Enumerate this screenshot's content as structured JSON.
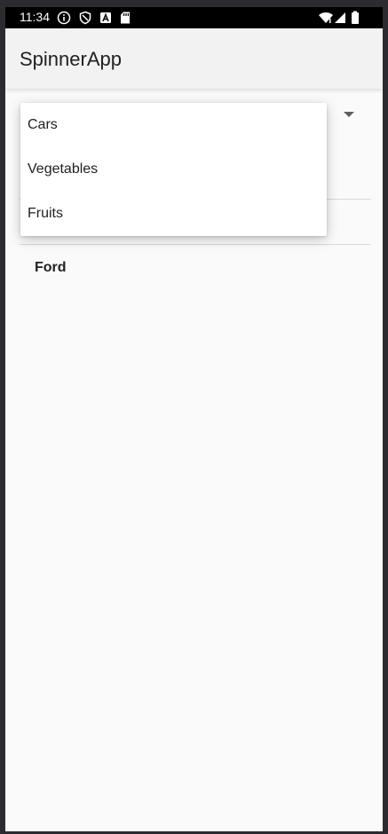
{
  "status_bar": {
    "time": "11:34",
    "icons": [
      "info-icon",
      "shield-icon",
      "a-icon",
      "sd-card-icon",
      "wifi-icon",
      "signal-icon",
      "battery-icon"
    ]
  },
  "app_bar": {
    "title": "SpinnerApp"
  },
  "spinner": {
    "icon": "dropdown-arrow-icon",
    "options": [
      {
        "label": "Cars"
      },
      {
        "label": "Vegetables"
      },
      {
        "label": "Fruits"
      }
    ]
  },
  "selected_item": {
    "label": "Ford"
  },
  "colors": {
    "background": "#fafafa",
    "app_bar": "#f2f2f2",
    "status_bar": "#000000",
    "text": "#212121"
  }
}
